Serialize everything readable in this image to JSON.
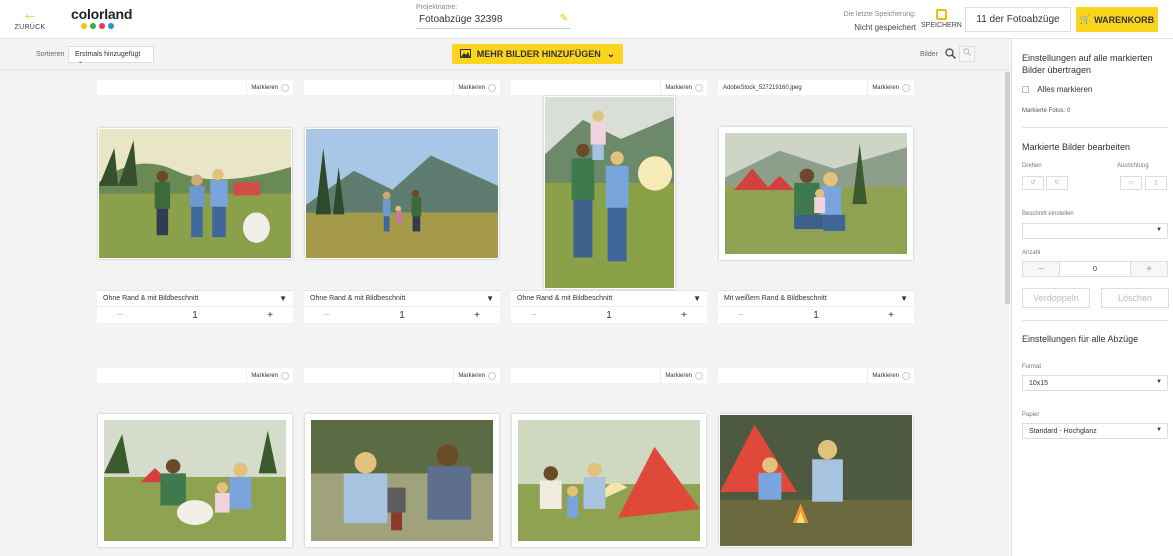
{
  "header": {
    "back_label": "ZURÜCK",
    "logo_text": "colorland",
    "logo_dot_colors": [
      "#f6c500",
      "#2eae4a",
      "#e8365b",
      "#2b8fd6"
    ],
    "project_caption": "Projektname:",
    "project_name": "Fotoabzüge 32398",
    "last_save_caption": "Die letzte Speicherung:",
    "last_save_value": "Nicht gespeichert",
    "save_label": "SPEICHERN",
    "count_label": "11 der Fotoabzüge",
    "cart_label": "WARENKORB",
    "accent_color": "#fbd51d"
  },
  "toolbar": {
    "sort_label": "Sortieren",
    "sort_value": "Erstmals hinzugefügt",
    "add_more_label": "MEHR BILDER HINZUFÜGEN",
    "images_label": "Bilder"
  },
  "cards": [
    {
      "filename": "",
      "mark_label": "Markieren",
      "option": "Ohne Rand & mit Bildbeschnitt",
      "qty": "1",
      "scene": "family-dog-field"
    },
    {
      "filename": "",
      "mark_label": "Markieren",
      "option": "Ohne Rand & mit Bildbeschnitt",
      "qty": "1",
      "scene": "family-mountains"
    },
    {
      "filename": "",
      "mark_label": "Markieren",
      "option": "Ohne Rand & mit Bildbeschnitt",
      "qty": "1",
      "scene": "family-lifting-child"
    },
    {
      "filename": "AdobeStock_527219160.jpeg",
      "mark_label": "Markieren",
      "option": "Mit weißem Rand & Bildbeschnitt",
      "qty": "1",
      "scene": "family-hug-tents"
    },
    {
      "filename": "",
      "mark_label": "Markieren",
      "option": "",
      "qty": "",
      "scene": "family-dog-sitting"
    },
    {
      "filename": "",
      "mark_label": "Markieren",
      "option": "",
      "qty": "",
      "scene": "couple-stove"
    },
    {
      "filename": "",
      "mark_label": "Markieren",
      "option": "",
      "qty": "",
      "scene": "family-red-tent"
    },
    {
      "filename": "",
      "mark_label": "Markieren",
      "option": "",
      "qty": "",
      "scene": "family-campfire"
    }
  ],
  "panel": {
    "transfer_title": "Einstellungen auf alle markierten Bilder übertragen",
    "mark_all_label": "Alles markieren",
    "marked_count_label": "Markierte Fotos: 0",
    "edit_title": "Markierte Bilder bearbeiten",
    "rotate_label": "Drehen",
    "orientation_label": "Ausrichtung",
    "crop_label": "Beschnitt einstellen",
    "crop_value": "",
    "amount_label": "Anzahl",
    "amount_value": "0",
    "duplicate_label": "Verdoppeln",
    "delete_label": "Löschen",
    "all_prints_title": "Einstellungen für alle Abzüge",
    "format_label": "Format",
    "format_value": "10x15",
    "paper_label": "Papier",
    "paper_value": "Standard - Hochglanz"
  }
}
